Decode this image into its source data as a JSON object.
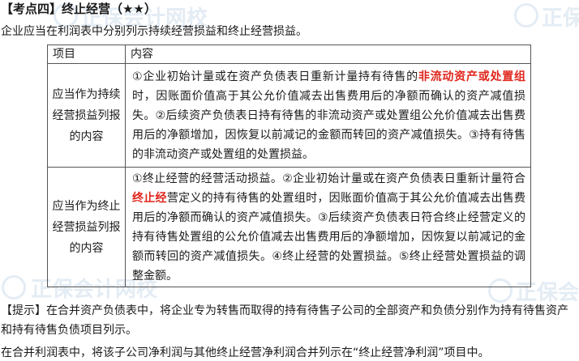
{
  "watermark": {
    "text": "正保会计网校"
  },
  "heading": {
    "bracket_label": "【考点四】",
    "title": "终止经营（★★）"
  },
  "intro": "企业应当在利润表中分别列示持续经营损益和终止经营损益。",
  "table": {
    "headers": [
      "项目",
      "内容"
    ],
    "rows": [
      {
        "item": "应当作为持续经营损益列报的内容",
        "content": [
          {
            "text": "①企业初始计量或在资产负债表日重新计量持有待售的"
          },
          {
            "text": "非流动资产或处置组",
            "highlight": true
          },
          {
            "text": "时，因账面价值高于其公允价值减去出售费用后的净额而确认的资产减值损失。②后续资产负债表日持有待售的非流动资产或处置组公允价值减去出售费用后的净额增加，因恢复以前减记的金额而转回的资产减值损失。③持有待售的非流动资产或处置组的处置损益。"
          }
        ]
      },
      {
        "item": "应当作为终止经营损益列报的内容",
        "content": [
          {
            "text": "①终止经营的经营活动损益。②企业初始计量或在资产负债表日重新计量符合"
          },
          {
            "text": "终止经",
            "highlight": true
          },
          {
            "text": "营定义的持有待售的处置组时，因账面价值高于其公允价值减去出售费用后的净额而确认的资产减值损失。③后续资产负债表日符合终止经营定义的持有待售处置组的公允价值减去出售费用后的净额增加，因恢复以前减记的金额而转回的资产减值损失。④终止经营的处置损益。⑤终止经营处置损益的调整金额。"
          }
        ]
      }
    ]
  },
  "note": "【提示】在合并资产负债表中，将企业专为转售而取得的持有待售子公司的全部资产和负债分别作为持有待售资产和持有待售负债项目列示。",
  "bottom_text": "在合并利润表中，将该子公司净利润与其他终止经营净利润合并列示在“终止经营净利润”项目中。",
  "colors": {
    "highlight": "#e0261c",
    "watermark": "#e4ecf4",
    "border": "#555555"
  }
}
